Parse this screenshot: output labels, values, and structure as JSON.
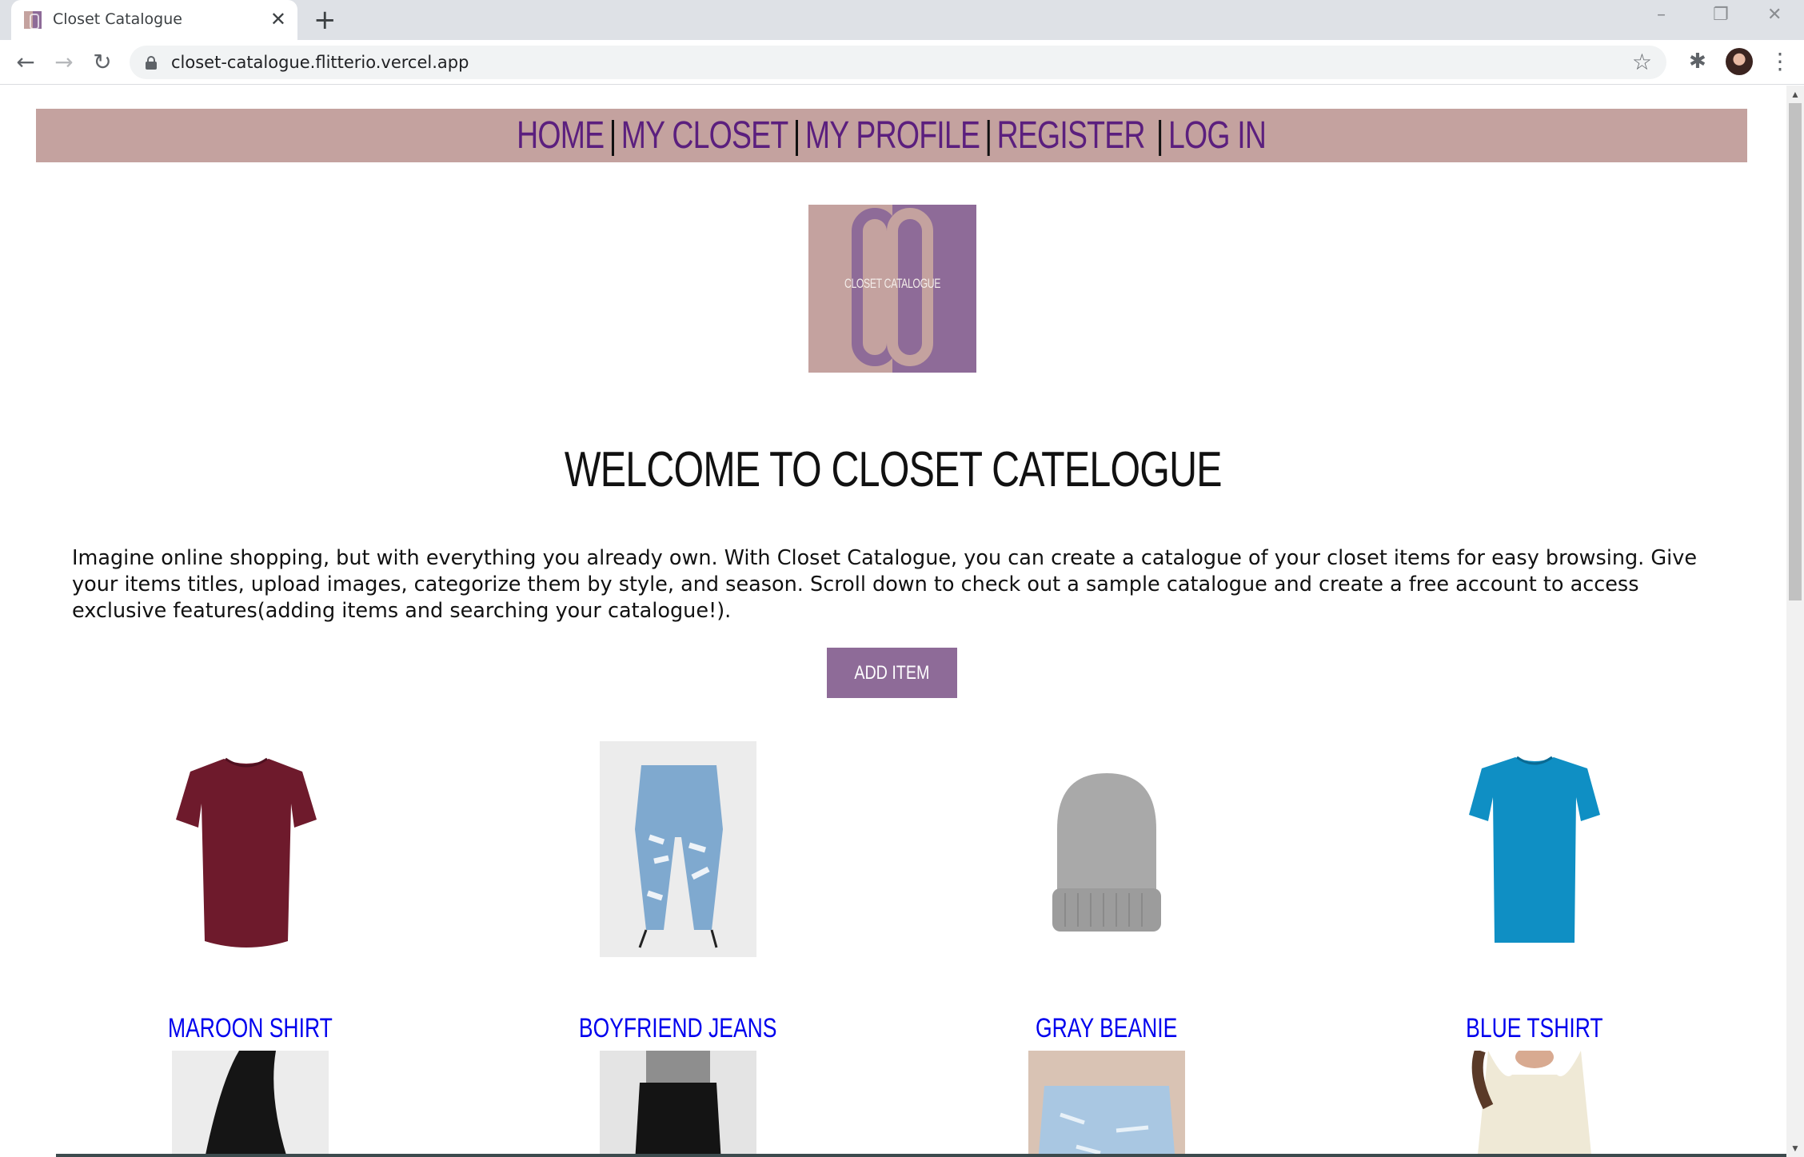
{
  "browser": {
    "tab_title": "Closet Catalogue",
    "tab_close": "✕",
    "new_tab": "+",
    "url": "closet-catalogue.flitterio.vercel.app",
    "window_controls": [
      "–",
      "❐",
      "✕"
    ]
  },
  "nav": {
    "items": [
      "HOME",
      "MY CLOSET",
      "MY PROFILE",
      "REGISTER",
      "LOG IN"
    ],
    "separator": "|"
  },
  "logo": {
    "text": "CLOSET CATALOGUE"
  },
  "welcome": "WELCOME TO CLOSET CATELOGUE",
  "intro": "Imagine online shopping, but with everything you already own. With Closet Catalogue, you can create a catalogue of your closet items for easy browsing. Give your items titles, upload images, categorize them by style, and season. Scroll down to check out a sample catalogue and create a free account to access exclusive features(adding items and searching your catalogue!).",
  "add_button": "ADD ITEM",
  "items": [
    {
      "title": "MAROON SHIRT",
      "color": "#6e1a2c"
    },
    {
      "title": "BOYFRIEND JEANS",
      "color": "#7fa9cf"
    },
    {
      "title": "GRAY BEANIE",
      "color": "#a9a9a9"
    },
    {
      "title": "BLUE TSHIRT",
      "color": "#0f8fc4"
    }
  ],
  "colors": {
    "nav_bg": "#c4a29f",
    "nav_text": "#5b1f7e",
    "button_bg": "#8e6b98",
    "link": "#0000ee"
  }
}
